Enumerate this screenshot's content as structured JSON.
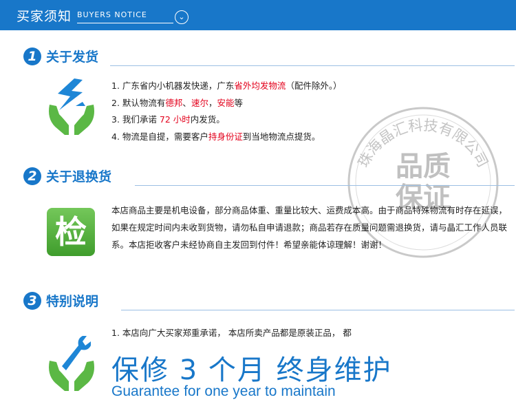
{
  "header": {
    "title_zh": "买家须知",
    "title_en": "BUYERS NOTICE"
  },
  "sections": [
    {
      "number": "1",
      "title": "关于发货",
      "items": [
        {
          "segments": [
            {
              "text": "1. 广东省内小机器发快递，广东",
              "red": false
            },
            {
              "text": "省外均发物流",
              "red": true
            },
            {
              "text": "（配件除外。）",
              "red": false
            }
          ]
        },
        {
          "segments": [
            {
              "text": "2. 默认物流有",
              "red": false
            },
            {
              "text": "德邦",
              "red": true
            },
            {
              "text": "、",
              "red": false
            },
            {
              "text": "速尔",
              "red": true
            },
            {
              "text": "，",
              "red": false
            },
            {
              "text": "安能",
              "red": true
            },
            {
              "text": "等",
              "red": false
            }
          ]
        },
        {
          "segments": [
            {
              "text": "3. 我们承诺 ",
              "red": false
            },
            {
              "text": "72 小时",
              "red": true
            },
            {
              "text": "内发货。",
              "red": false
            }
          ]
        },
        {
          "segments": [
            {
              "text": "4. 物流是自提，需要客户",
              "red": false
            },
            {
              "text": "持身份证",
              "red": true
            },
            {
              "text": "到当地物流点提货。",
              "red": false
            }
          ]
        }
      ]
    },
    {
      "number": "2",
      "title": "关于退换货",
      "badge_char": "检",
      "paragraph": "本店商品主要是机电设备，部分商品体重、重量比较大、运费成本高。由于商品特殊物流有时存在延误，如果在规定时间内未收到货物，请勿私自申请退款；商品若存在质量问题需退换货，请与晶汇工作人员联系。本店拒收客户未经协商自主发回到付件！希望亲能体谅理解！谢谢！"
    },
    {
      "number": "3",
      "title": "特别说明",
      "line1": "1. 本店向广大买家郑重承诺，  本店所卖产品都是原装正品，  都",
      "big_zh": "保修 3 个月  终身维护",
      "big_en": "Guarantee for one year to maintain"
    }
  ],
  "stamp": {
    "company": "珠海晶汇科技有限公司",
    "line1": "品质",
    "line2": "保证"
  },
  "colors": {
    "brand_blue": "#1877c9",
    "highlight_red": "#e3001b",
    "icon_green": "#5bb845"
  }
}
